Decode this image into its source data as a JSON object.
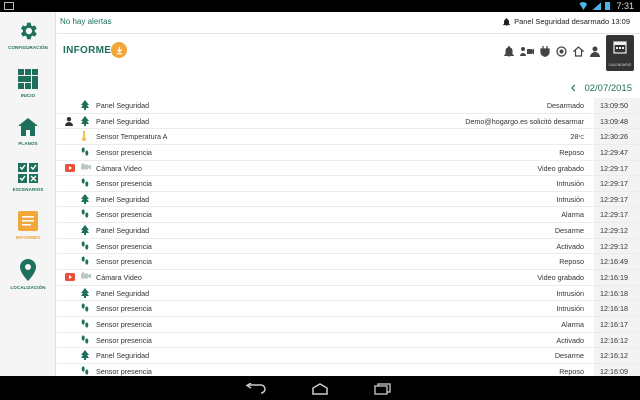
{
  "status_bar": {
    "time": "7:31"
  },
  "sidebar": {
    "items": [
      {
        "label": "CONFIGURACIÓN",
        "icon": "gear-icon"
      },
      {
        "label": "INICIO",
        "icon": "grid-icon"
      },
      {
        "label": "PLANOS",
        "icon": "house-icon"
      },
      {
        "label": "ESCENARIOS",
        "icon": "scenarios-icon"
      },
      {
        "label": "INFORMES",
        "icon": "reports-icon",
        "active": true
      },
      {
        "label": "LOCALIZACIÓN",
        "icon": "location-pin-icon"
      }
    ]
  },
  "topbar": {
    "alerts": "No hay alertas",
    "panel_state": "Panel Seguridad desarmado 13:09"
  },
  "header": {
    "title": "INFORMES",
    "calendar_label": "CALENDARIO"
  },
  "date_nav": {
    "date": "02/07/2015"
  },
  "log": [
    {
      "severity": "",
      "icon": "tree",
      "name": "Panel Seguridad",
      "event": "Desarmado",
      "time": "13:09:50"
    },
    {
      "severity": "user",
      "icon": "tree",
      "name": "Panel Seguridad",
      "event": "Demo@hogargo.es solicitó desarmar",
      "time": "13:09:48"
    },
    {
      "severity": "",
      "icon": "thermo",
      "name": "Sensor Temperatura A",
      "event": "28",
      "unit": "°C",
      "time": "12:30:26"
    },
    {
      "severity": "",
      "icon": "steps",
      "name": "Sensor presencia",
      "event": "Reposo",
      "time": "12:29:47"
    },
    {
      "severity": "video",
      "icon": "camera",
      "name": "Cámara Video",
      "event": "Video grabado",
      "time": "12:29:17"
    },
    {
      "severity": "",
      "icon": "steps",
      "name": "Sensor presencia",
      "event": "Intrusión",
      "time": "12:29:17"
    },
    {
      "severity": "",
      "icon": "tree",
      "name": "Panel Seguridad",
      "event": "Intrusión",
      "time": "12:29:17"
    },
    {
      "severity": "",
      "icon": "steps",
      "name": "Sensor presencia",
      "event": "Alarma",
      "time": "12:29:17"
    },
    {
      "severity": "",
      "icon": "tree",
      "name": "Panel Seguridad",
      "event": "Desarme",
      "time": "12:29:12"
    },
    {
      "severity": "",
      "icon": "steps",
      "name": "Sensor presencia",
      "event": "Activado",
      "time": "12:29:12"
    },
    {
      "severity": "",
      "icon": "steps",
      "name": "Sensor presencia",
      "event": "Reposo",
      "time": "12:16:49"
    },
    {
      "severity": "video",
      "icon": "camera",
      "name": "Cámara Video",
      "event": "Video grabado",
      "time": "12:16:19"
    },
    {
      "severity": "",
      "icon": "tree",
      "name": "Panel Seguridad",
      "event": "Intrusión",
      "time": "12:16:18"
    },
    {
      "severity": "",
      "icon": "steps",
      "name": "Sensor presencia",
      "event": "Intrusión",
      "time": "12:16:18"
    },
    {
      "severity": "",
      "icon": "steps",
      "name": "Sensor presencia",
      "event": "Alarma",
      "time": "12:16:17"
    },
    {
      "severity": "",
      "icon": "steps",
      "name": "Sensor presencia",
      "event": "Activado",
      "time": "12:16:12"
    },
    {
      "severity": "",
      "icon": "tree",
      "name": "Panel Seguridad",
      "event": "Desarme",
      "time": "12:16:12"
    },
    {
      "severity": "",
      "icon": "steps",
      "name": "Sensor presencia",
      "event": "Reposo",
      "time": "12:16:09"
    }
  ],
  "colors": {
    "brand_green": "#1e6f5c",
    "accent_orange": "#f2a73b",
    "video_red": "#e8523a"
  }
}
